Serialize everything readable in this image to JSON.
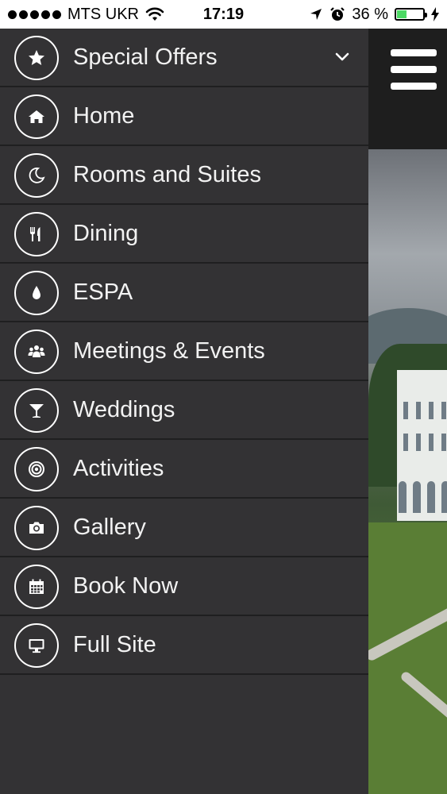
{
  "status_bar": {
    "carrier": "MTS UKR",
    "time": "17:19",
    "battery_percent": "36 %",
    "battery_level": 0.36
  },
  "menu": {
    "items": [
      {
        "label": "Special Offers",
        "icon": "star-icon"
      },
      {
        "label": "Home",
        "icon": "home-icon"
      },
      {
        "label": "Rooms and Suites",
        "icon": "moon-icon"
      },
      {
        "label": "Dining",
        "icon": "utensils-icon"
      },
      {
        "label": "ESPA",
        "icon": "drop-icon"
      },
      {
        "label": "Meetings & Events",
        "icon": "group-icon"
      },
      {
        "label": "Weddings",
        "icon": "cocktail-icon"
      },
      {
        "label": "Activities",
        "icon": "target-icon"
      },
      {
        "label": "Gallery",
        "icon": "camera-icon"
      },
      {
        "label": "Book Now",
        "icon": "calendar-icon"
      },
      {
        "label": "Full Site",
        "icon": "desktop-icon"
      }
    ]
  },
  "colors": {
    "menu_bg": "#333234",
    "divider": "#1f1f20",
    "text": "#f2f2f2",
    "battery_fill": "#4cd964"
  }
}
